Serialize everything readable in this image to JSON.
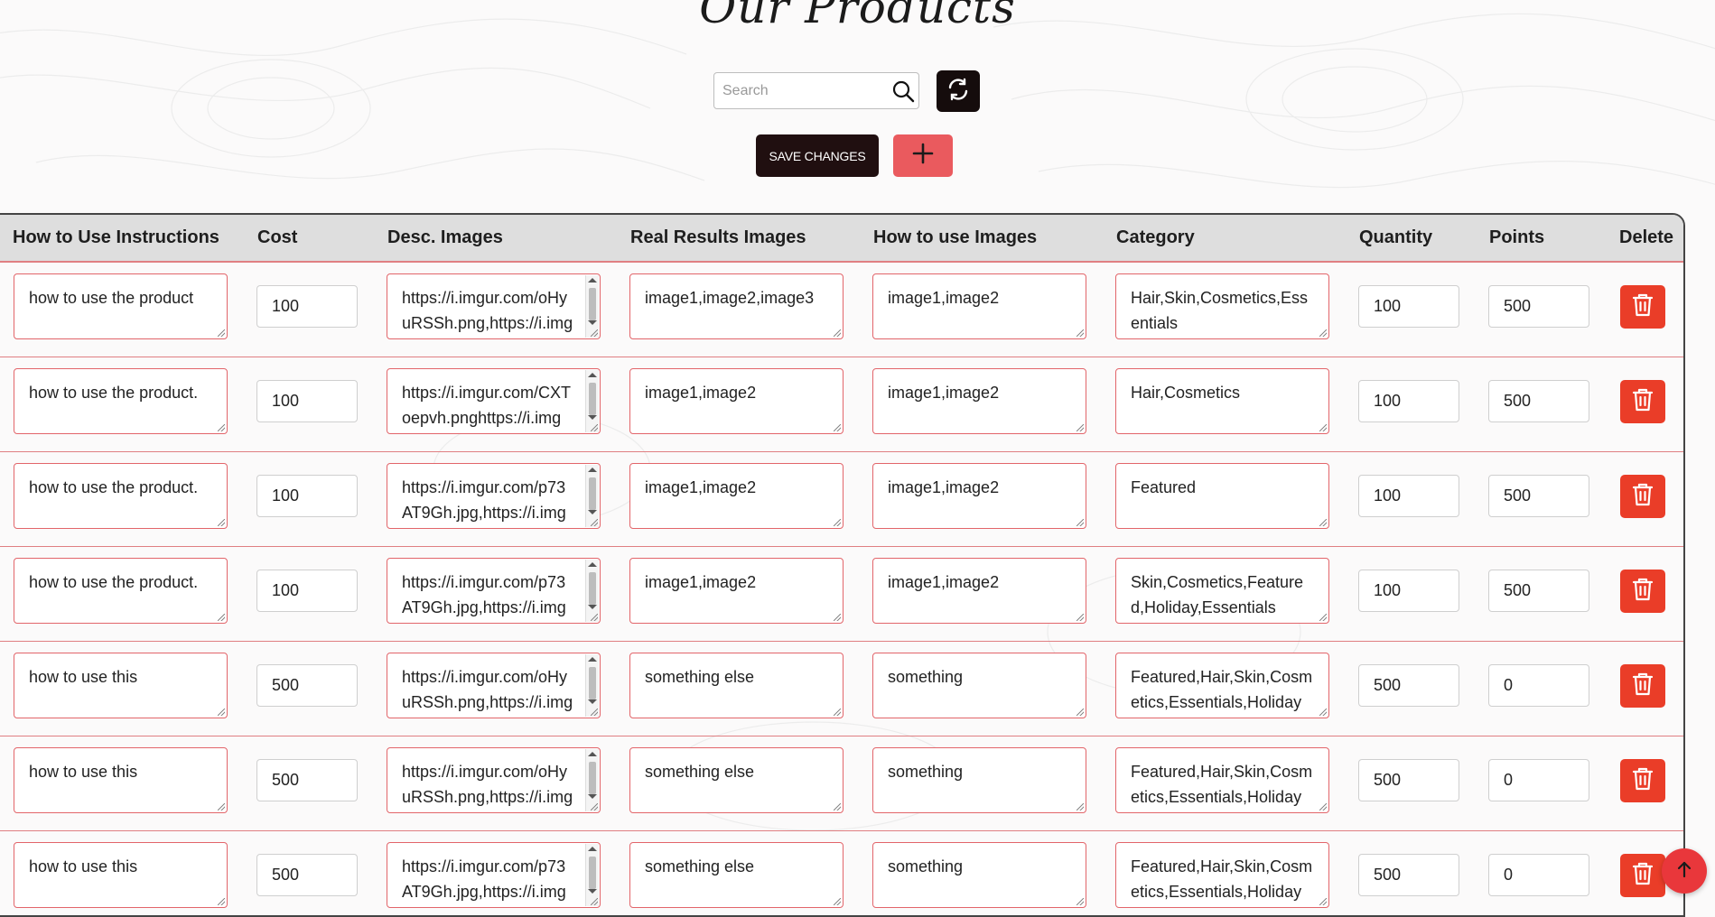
{
  "page": {
    "title": "Our Products"
  },
  "search": {
    "placeholder": "Search",
    "value": ""
  },
  "toolbar": {
    "save_label": "SAVE CHANGES"
  },
  "table": {
    "columns": [
      "How to Use Instructions",
      "Cost",
      "Desc. Images",
      "Real Results Images",
      "How to use Images",
      "Category",
      "Quantity",
      "Points",
      "Delete"
    ],
    "rows": [
      {
        "instructions": "how to use the product",
        "cost": "100",
        "desc_images": "https://i.imgur.com/oHyuRSSh.png,https://i.img",
        "real_results": "image1,image2,image3",
        "how_to_images": "image1,image2",
        "category": "Hair,Skin,Cosmetics,Essentials",
        "quantity": "100",
        "points": "500"
      },
      {
        "instructions": "how to use the product.",
        "cost": "100",
        "desc_images": "https://i.imgur.com/CXToepvh.pnghttps://i.img",
        "real_results": "image1,image2",
        "how_to_images": "image1,image2",
        "category": "Hair,Cosmetics",
        "quantity": "100",
        "points": "500"
      },
      {
        "instructions": "how to use the product.",
        "cost": "100",
        "desc_images": "https://i.imgur.com/p73AT9Gh.jpg,https://i.img",
        "real_results": "image1,image2",
        "how_to_images": "image1,image2",
        "category": "Featured",
        "quantity": "100",
        "points": "500"
      },
      {
        "instructions": "how to use the product.",
        "cost": "100",
        "desc_images": "https://i.imgur.com/p73AT9Gh.jpg,https://i.img",
        "real_results": "image1,image2",
        "how_to_images": "image1,image2",
        "category": "Skin,Cosmetics,Featured,Holiday,Essentials",
        "quantity": "100",
        "points": "500"
      },
      {
        "instructions": "how to use this",
        "cost": "500",
        "desc_images": "https://i.imgur.com/oHyuRSSh.png,https://i.img",
        "real_results": "something else",
        "how_to_images": "something",
        "category": "Featured,Hair,Skin,Cosmetics,Essentials,Holiday",
        "quantity": "500",
        "points": "0"
      },
      {
        "instructions": "how to use this",
        "cost": "500",
        "desc_images": "https://i.imgur.com/oHyuRSSh.png,https://i.img",
        "real_results": "something else",
        "how_to_images": "something",
        "category": "Featured,Hair,Skin,Cosmetics,Essentials,Holiday",
        "quantity": "500",
        "points": "0"
      },
      {
        "instructions": "how to use this",
        "cost": "500",
        "desc_images": "https://i.imgur.com/p73AT9Gh.jpg,https://i.img",
        "real_results": "something else",
        "how_to_images": "something",
        "category": "Featured,Hair,Skin,Cosmetics,Essentials,Holiday",
        "quantity": "500",
        "points": "0"
      }
    ]
  },
  "icons": {
    "search": "search-icon",
    "refresh": "refresh-icon",
    "add": "plus-icon",
    "delete": "trash-icon",
    "scroll_top": "arrow-up-icon"
  },
  "colors": {
    "dark_button": "#200f10",
    "add_button": "#ea5a5e",
    "delete_button": "#ea3d28",
    "row_border": "#e07f82",
    "header_bg": "#dedede"
  }
}
